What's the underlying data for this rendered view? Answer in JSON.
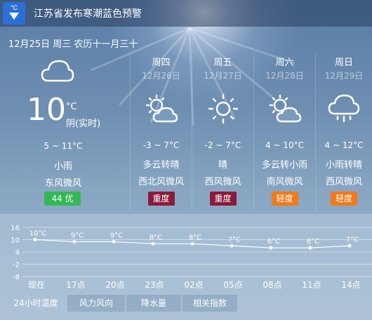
{
  "alert": {
    "unit": "°C",
    "text": "江苏省发布寒潮蓝色预警"
  },
  "date_line": "12月25日 周三 农历十一月三十",
  "today": {
    "icon": "cloud-icon",
    "temp": "10",
    "unit": "°C",
    "condition_realtime": "阴(实时)",
    "range": "5 ~ 11°C",
    "weather": "小雨",
    "wind": "东风微风",
    "aqi": "44 优",
    "aqi_color": "#33b854"
  },
  "forecast": [
    {
      "day": "周四",
      "date": "12月26日",
      "icon": "partly-cloudy-icon",
      "range": "-3 ~ 7°C",
      "weather": "多云转晴",
      "wind": "西北风微风",
      "aqi": "重度",
      "aqi_level": "heavy"
    },
    {
      "day": "周五",
      "date": "12月27日",
      "icon": "sun-icon",
      "range": "-2 ~ 7°C",
      "weather": "晴",
      "wind": "西风微风",
      "aqi": "重度",
      "aqi_level": "heavy"
    },
    {
      "day": "周六",
      "date": "12月28日",
      "icon": "partly-cloudy-icon",
      "range": "4 ~ 10°C",
      "weather": "多云转小雨",
      "wind": "南风微风",
      "aqi": "轻度",
      "aqi_level": "light"
    },
    {
      "day": "周日",
      "date": "12月29日",
      "icon": "rain-cloud-icon",
      "range": "4 ~ 12°C",
      "weather": "小雨转晴",
      "wind": "西风微风",
      "aqi": "轻度",
      "aqi_level": "light"
    }
  ],
  "tabs": [
    "24小时温度",
    "风力风向",
    "降水量",
    "相关指数"
  ],
  "colors": {
    "aqi_heavy": "#8a1b3c",
    "aqi_light": "#f07a1c",
    "aqi_good": "#33b854"
  },
  "chart_data": {
    "type": "line",
    "categories": [
      "现在",
      "17点",
      "20点",
      "23点",
      "02点",
      "05点",
      "08点",
      "11点",
      "14点"
    ],
    "values": [
      10,
      9,
      9,
      8,
      8,
      7,
      6,
      6,
      7
    ],
    "labels": [
      "10°C",
      "9°C",
      "9°C",
      "8°C",
      "8°C",
      "7°C",
      "6°C",
      "6°C",
      "7°C"
    ],
    "yticks": [
      16,
      10,
      4,
      -2,
      -8
    ],
    "ylim": [
      -8,
      16
    ],
    "grid": true
  }
}
